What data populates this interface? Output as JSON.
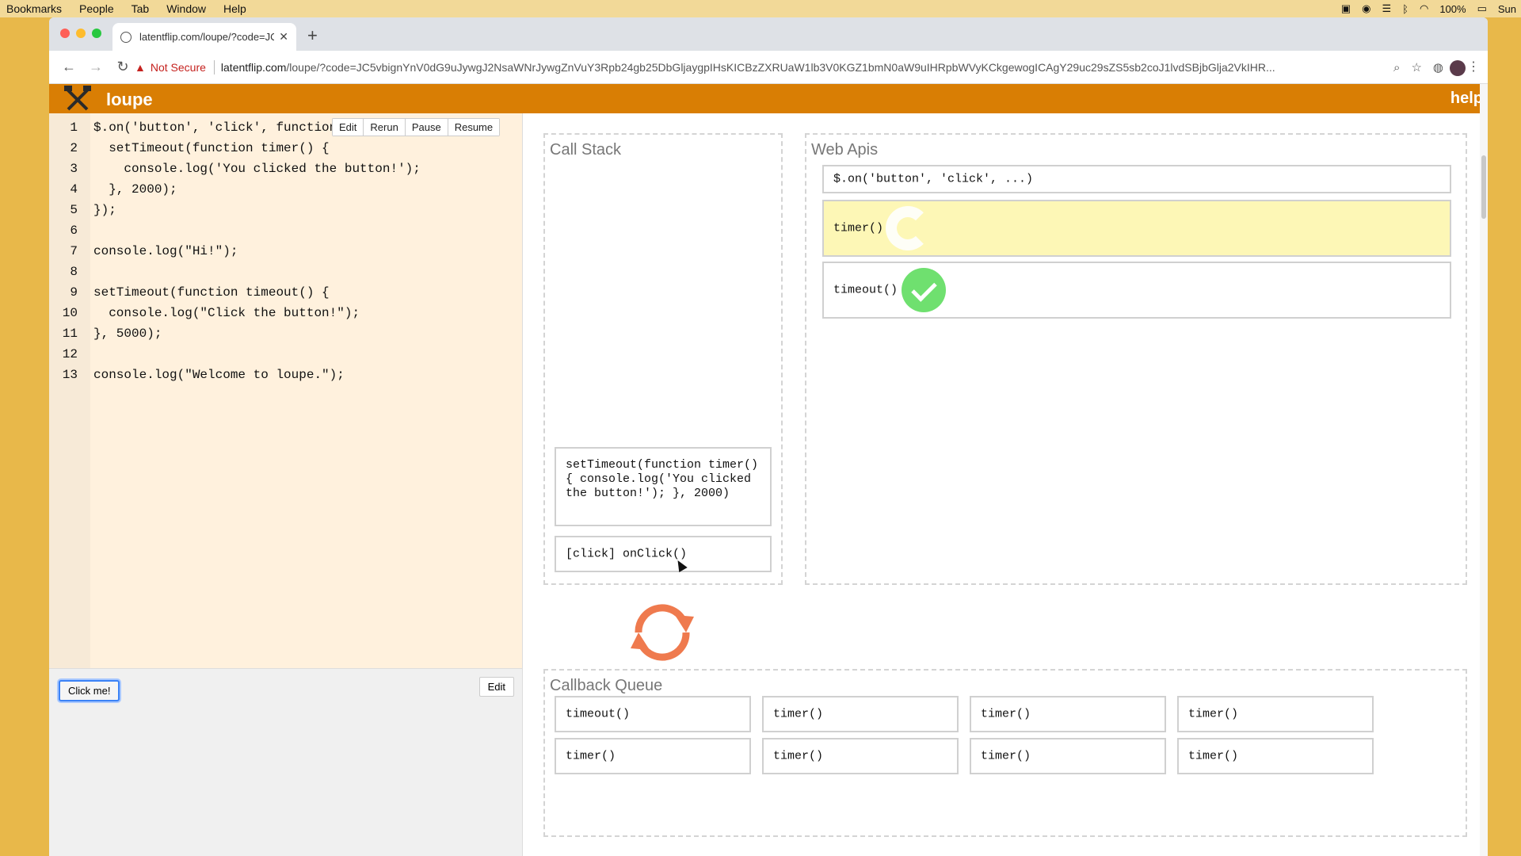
{
  "menubar": {
    "items": [
      "Bookmarks",
      "People",
      "Tab",
      "Window",
      "Help"
    ],
    "battery": "100%",
    "clock": "Sun"
  },
  "browser": {
    "tab_title": "latentflip.com/loupe/?code=JC",
    "security_label": "Not Secure",
    "url_host": "latentflip.com",
    "url_rest": "/loupe/?code=JC5vbignYnV0dG9uJywgJ2NsaWNrJywgZnVuY3Rpb24gb25DbGljaygpIHsKICBzZXRUaW1lb3V0KGZ1bmN0aW9uIHRpbWVyKCkgewogICAgY29uc29sZS5sb2coJ1lvdSBjbGlja2VkIHR..."
  },
  "app": {
    "name": "loupe",
    "help_label": "help",
    "colors": {
      "brand": "#d97e04",
      "editor_bg": "#fff1dd",
      "highlight": "#fdf7b6",
      "check": "#6fe06f",
      "loop": "#ef7a4e"
    }
  },
  "editor": {
    "buttons": [
      "Edit",
      "Rerun",
      "Pause",
      "Resume"
    ],
    "lines": [
      {
        "n": "1",
        "code": "$.on('button', 'click', function onClick() {"
      },
      {
        "n": "2",
        "code": "  setTimeout(function timer() {"
      },
      {
        "n": "3",
        "code": "    console.log('You clicked the button!');"
      },
      {
        "n": "4",
        "code": "  }, 2000);"
      },
      {
        "n": "5",
        "code": "});"
      },
      {
        "n": "6",
        "code": ""
      },
      {
        "n": "7",
        "code": "console.log(\"Hi!\");"
      },
      {
        "n": "8",
        "code": ""
      },
      {
        "n": "9",
        "code": "setTimeout(function timeout() {"
      },
      {
        "n": "10",
        "code": "  console.log(\"Click the button!\");"
      },
      {
        "n": "11",
        "code": "}, 5000);"
      },
      {
        "n": "12",
        "code": ""
      },
      {
        "n": "13",
        "code": "console.log(\"Welcome to loupe.\");"
      }
    ]
  },
  "preview": {
    "click_button": "Click me!",
    "edit_button": "Edit"
  },
  "call_stack": {
    "title": "Call Stack",
    "frames": [
      "setTimeout(function timer() { console.log('You clicked the button!'); }, 2000)",
      "[click] onClick()"
    ]
  },
  "web_apis": {
    "title": "Web Apis",
    "items": [
      {
        "label": "$.on('button', 'click', ...)",
        "state": "idle"
      },
      {
        "label": "timer()",
        "state": "running"
      },
      {
        "label": "timeout()",
        "state": "done"
      }
    ]
  },
  "callback_queue": {
    "title": "Callback Queue",
    "items": [
      "timeout()",
      "timer()",
      "timer()",
      "timer()",
      "timer()",
      "timer()",
      "timer()",
      "timer()"
    ]
  }
}
